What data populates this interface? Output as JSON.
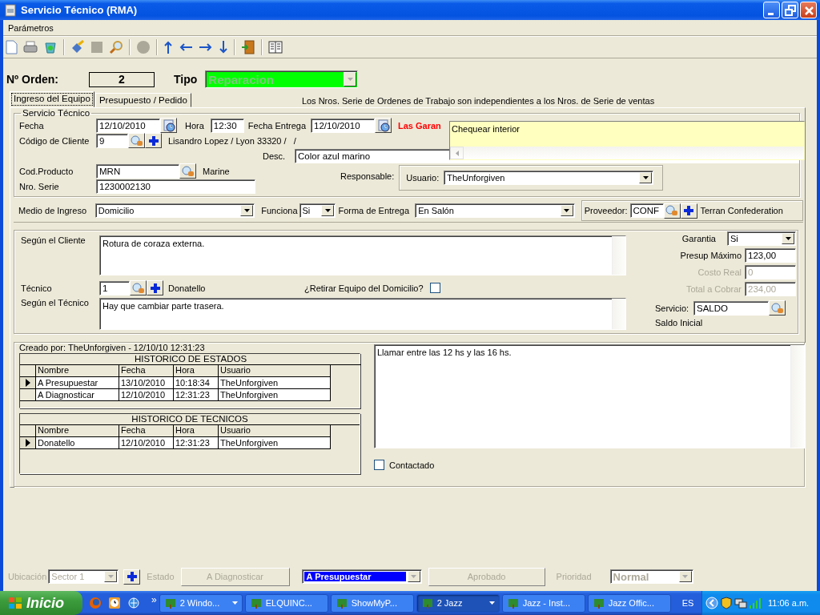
{
  "window": {
    "title": "Servicio Técnico (RMA)"
  },
  "menu": [
    {
      "label": "Parámetros"
    }
  ],
  "order": {
    "label": "Nº Orden:",
    "number": "2",
    "tipo_label": "Tipo",
    "tipo": "Reparacion"
  },
  "tabs": [
    {
      "label": "Ingreso del Equipo",
      "selected": true
    },
    {
      "label": "Presupuesto / Pedido",
      "selected": false
    }
  ],
  "note": "Los Nros. Serie de Ordenes de Trabajo son independientes a los Nros. de Serie de ventas",
  "servicio": {
    "legend": "Servicio Técnico",
    "fecha_label": "Fecha",
    "fecha": "12/10/2010",
    "hora_label": "Hora",
    "hora": "12:30",
    "entrega_label": "Fecha Entrega",
    "entrega": "12/10/2010",
    "warning": "Las Garan",
    "cliente_label": "Código de Cliente",
    "cliente": "9",
    "cliente_info": "Lisandro Lopez / Lyon 33320 /   /",
    "desc_label": "Desc.",
    "desc": "Color azul marino",
    "producto_label": "Cod.Producto",
    "producto": "MRN",
    "producto_name": "Marine",
    "serie_label": "Nro. Serie",
    "serie": "1230002130",
    "responsable_label": "Responsable:",
    "usuario_label": "Usuario:",
    "usuario": "TheUnforgiven"
  },
  "popup": {
    "text": "Chequear interior"
  },
  "ingreso": {
    "medio_label": "Medio de Ingreso",
    "medio": "Domicilio",
    "funciona_label": "Funciona",
    "funciona": "Si",
    "forma_label": "Forma de Entrega",
    "forma": "En Salón",
    "proveedor_label": "Proveedor:",
    "proveedor": "CONF",
    "proveedor_name": "Terran Confederation"
  },
  "detalle": {
    "cliente_label": "Según el Cliente",
    "cliente_text": "Rotura de coraza externa.",
    "tecnico_label": "Técnico",
    "tecnico": "1",
    "tecnico_name": "Donatello",
    "retirar_label": "¿Retirar Equipo del Domicilio?",
    "retirar_checked": false,
    "segun_tecnico_label": "Según el Técnico",
    "tecnico_text": "Hay que cambiar parte trasera.",
    "garantia_label": "Garantia",
    "garantia": "Si",
    "amounts": [
      {
        "label": "Presup Máximo",
        "value": "123,00",
        "disabled": false
      },
      {
        "label": "Costo Real",
        "value": "0",
        "disabled": true
      },
      {
        "label": "Total a Cobrar",
        "value": "234,00",
        "disabled": true
      }
    ],
    "servicio_label": "Servicio:",
    "servicio": "SALDO",
    "servicio_name": "Saldo Inicial"
  },
  "historial": {
    "creado": "Creado por: TheUnforgiven - 12/10/10 12:31:23",
    "grids": [
      {
        "title": "HISTORICO DE ESTADOS",
        "columns": [
          "Nombre",
          "Fecha",
          "Hora",
          "Usuario"
        ],
        "rows": [
          {
            "cells": [
              "A Presupuestar",
              "13/10/2010",
              "10:18:34",
              "TheUnforgiven"
            ],
            "selected": true
          },
          {
            "cells": [
              "A Diagnosticar",
              "12/10/2010",
              "12:31:23",
              "TheUnforgiven"
            ],
            "selected": false
          }
        ]
      },
      {
        "title": "HISTORICO DE TECNICOS",
        "columns": [
          "Nombre",
          "Fecha",
          "Hora",
          "Usuario"
        ],
        "rows": [
          {
            "cells": [
              "Donatello",
              "12/10/2010",
              "12:31:23",
              "TheUnforgiven"
            ],
            "selected": true
          }
        ]
      }
    ],
    "notes": "Llamar entre las 12 hs y las 16 hs.",
    "contactado_label": "Contactado",
    "contactado": false
  },
  "status": {
    "ubicacion_label": "Ubicación",
    "ubicacion": "Sector 1",
    "estado_label": "Estado",
    "prev_button": "A Diagnosticar",
    "estado": "A Presupuestar",
    "next_button": "Aprobado",
    "prioridad_label": "Prioridad",
    "prioridad": "Normal",
    "disabled": true
  },
  "taskbar": {
    "start": "Inicio",
    "more": "»",
    "tasks": [
      {
        "label": "2 Windo...",
        "selected": false,
        "grouped": true
      },
      {
        "label": "ELQUINC...",
        "selected": false,
        "grouped": false
      },
      {
        "label": "ShowMyP...",
        "selected": false,
        "grouped": false
      },
      {
        "label": "2 Jazz",
        "selected": true,
        "grouped": true
      },
      {
        "label": "Jazz - Inst...",
        "selected": false,
        "grouped": false
      },
      {
        "label": "Jazz Offic...",
        "selected": false,
        "grouped": false
      }
    ],
    "lang": "ES",
    "clock": "11:06 a.m."
  }
}
